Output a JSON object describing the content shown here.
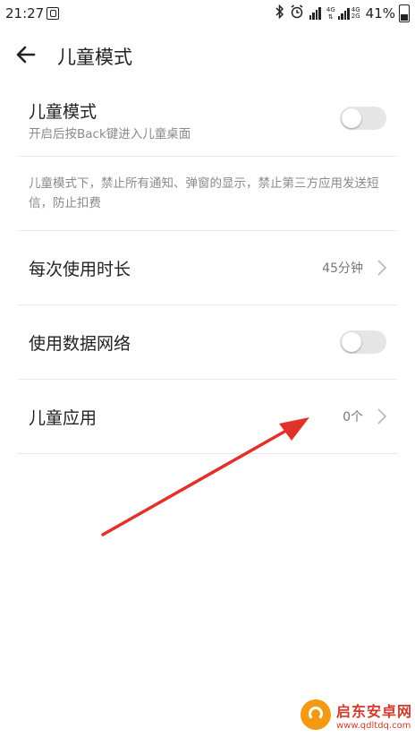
{
  "status_bar": {
    "time": "21:27",
    "net_top": "4G",
    "net_bottom": "2G",
    "battery": "41%",
    "battery_level": 0.41
  },
  "app_bar": {
    "title": "儿童模式"
  },
  "settings": {
    "kid_mode": {
      "title": "儿童模式",
      "subtitle": "开启后按Back键进入儿童桌面",
      "enabled": false
    },
    "note": "儿童模式下，禁止所有通知、弹窗的显示，禁止第三方应用发送短信，防止扣费",
    "duration": {
      "title": "每次使用时长",
      "value": "45分钟"
    },
    "mobile_data": {
      "title": "使用数据网络",
      "enabled": false
    },
    "kid_apps": {
      "title": "儿童应用",
      "value": "0个"
    }
  },
  "annotation": {
    "color": "#e0322a"
  },
  "watermark": {
    "name": "启东安卓网",
    "url": "www.qdltdq.com"
  }
}
